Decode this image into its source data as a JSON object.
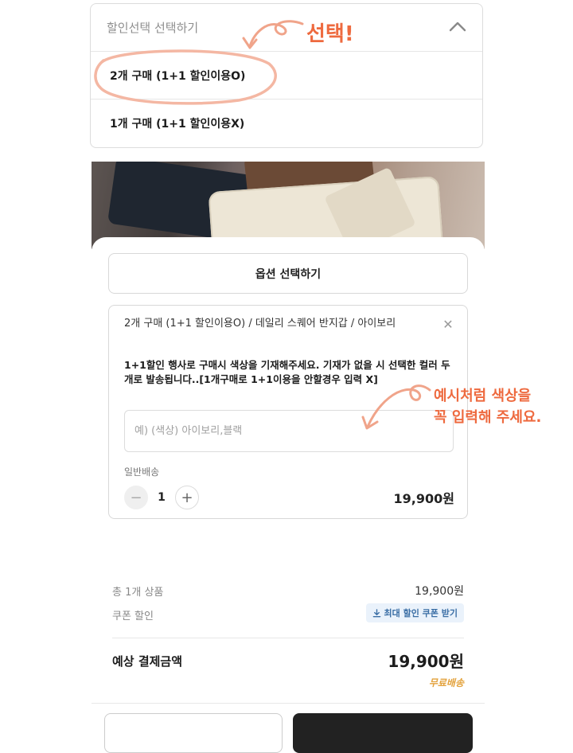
{
  "dropdown": {
    "placeholder": "할인선택 선택하기",
    "items": [
      {
        "label": "2개 구매 (1+1 할인이용O)"
      },
      {
        "label": "1개 구매 (1+1 할인이용X)"
      }
    ]
  },
  "sheet": {
    "option_button_label": "옵션 선택하기",
    "option": {
      "title": "2개 구매 (1+1 할인이용O) / 데일리 스퀘어 반지갑 / 아이보리",
      "notice": "1+1할인 행사로 구매시 색상을 기재해주세요. 기재가 없을 시 선택한 컬러 두개로 발송됩니다..[1개구매로 1+1이용을 안할경우 입력 X]",
      "input_placeholder": "예) (색상) 아이보리,블랙",
      "input_value": "",
      "shipping_label": "일반배송",
      "quantity": "1",
      "price": "19,900원"
    }
  },
  "summary": {
    "total_items_label": "총 1개 상품",
    "total_items_value": "19,900원",
    "coupon_label": "쿠폰 할인",
    "coupon_button": "최대 할인 쿠폰 받기",
    "expected_label": "예상 결제금액",
    "expected_value": "19,900원",
    "free_shipping": "무료배송"
  },
  "annotations": {
    "select_text": "선택!",
    "example_line1": "예시처럼  색상을",
    "example_line2": "꼭 입력해 주세요."
  },
  "colors": {
    "annotation": "#ee6a3f",
    "free_shipping": "#e3a23c",
    "coupon_text": "#3a6ea5",
    "primary_button": "#222222"
  }
}
